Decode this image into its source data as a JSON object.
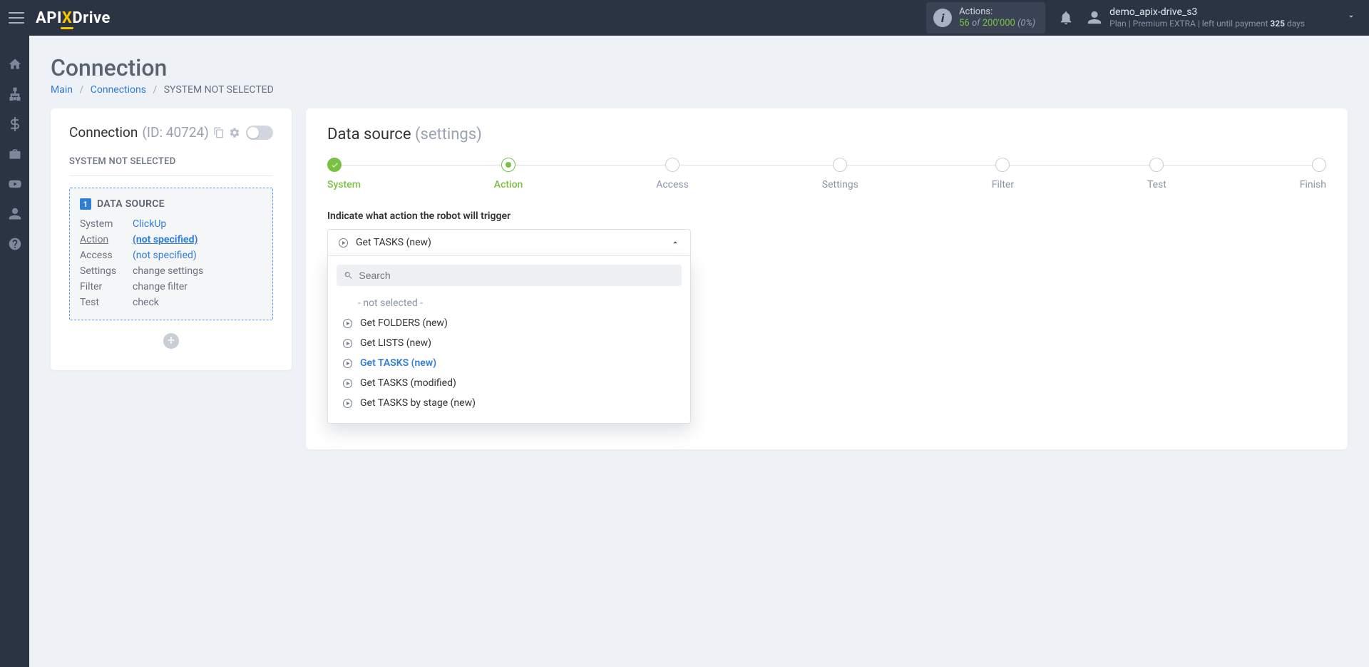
{
  "header": {
    "logo": {
      "api": "API",
      "x": "X",
      "drive": "Drive"
    },
    "actions": {
      "label": "Actions:",
      "count": "56",
      "of": "of",
      "total": "200'000",
      "pct": "(0%)"
    },
    "user": {
      "name": "demo_apix-drive_s3",
      "plan_prefix": "Plan |",
      "plan_name": "Premium EXTRA",
      "plan_suffix": "| left until payment",
      "days": "325",
      "days_label": "days"
    }
  },
  "page": {
    "title": "Connection",
    "breadcrumb": {
      "main": "Main",
      "connections": "Connections",
      "current": "SYSTEM NOT SELECTED"
    }
  },
  "left": {
    "head": "Connection",
    "id": "(ID: 40724)",
    "system_not_selected": "SYSTEM NOT SELECTED",
    "ds_badge": "1",
    "ds_title": "DATA SOURCE",
    "rows": {
      "system_k": "System",
      "system_v": "ClickUp",
      "action_k": "Action",
      "action_v": "(not specified)",
      "access_k": "Access",
      "access_v": "(not specified)",
      "settings_k": "Settings",
      "settings_v": "change settings",
      "filter_k": "Filter",
      "filter_v": "change filter",
      "test_k": "Test",
      "test_v": "check"
    }
  },
  "right": {
    "head": "Data source",
    "head_sub": "(settings)",
    "steps": [
      "System",
      "Action",
      "Access",
      "Settings",
      "Filter",
      "Test",
      "Finish"
    ],
    "field_label": "Indicate what action the robot will trigger",
    "selected_option": "Get TASKS (new)",
    "search_placeholder": "Search",
    "options": {
      "none": "- not selected -",
      "o1": "Get FOLDERS (new)",
      "o2": "Get LISTS (new)",
      "o3": "Get TASKS (new)",
      "o4": "Get TASKS (modified)",
      "o5": "Get TASKS by stage (new)"
    }
  }
}
